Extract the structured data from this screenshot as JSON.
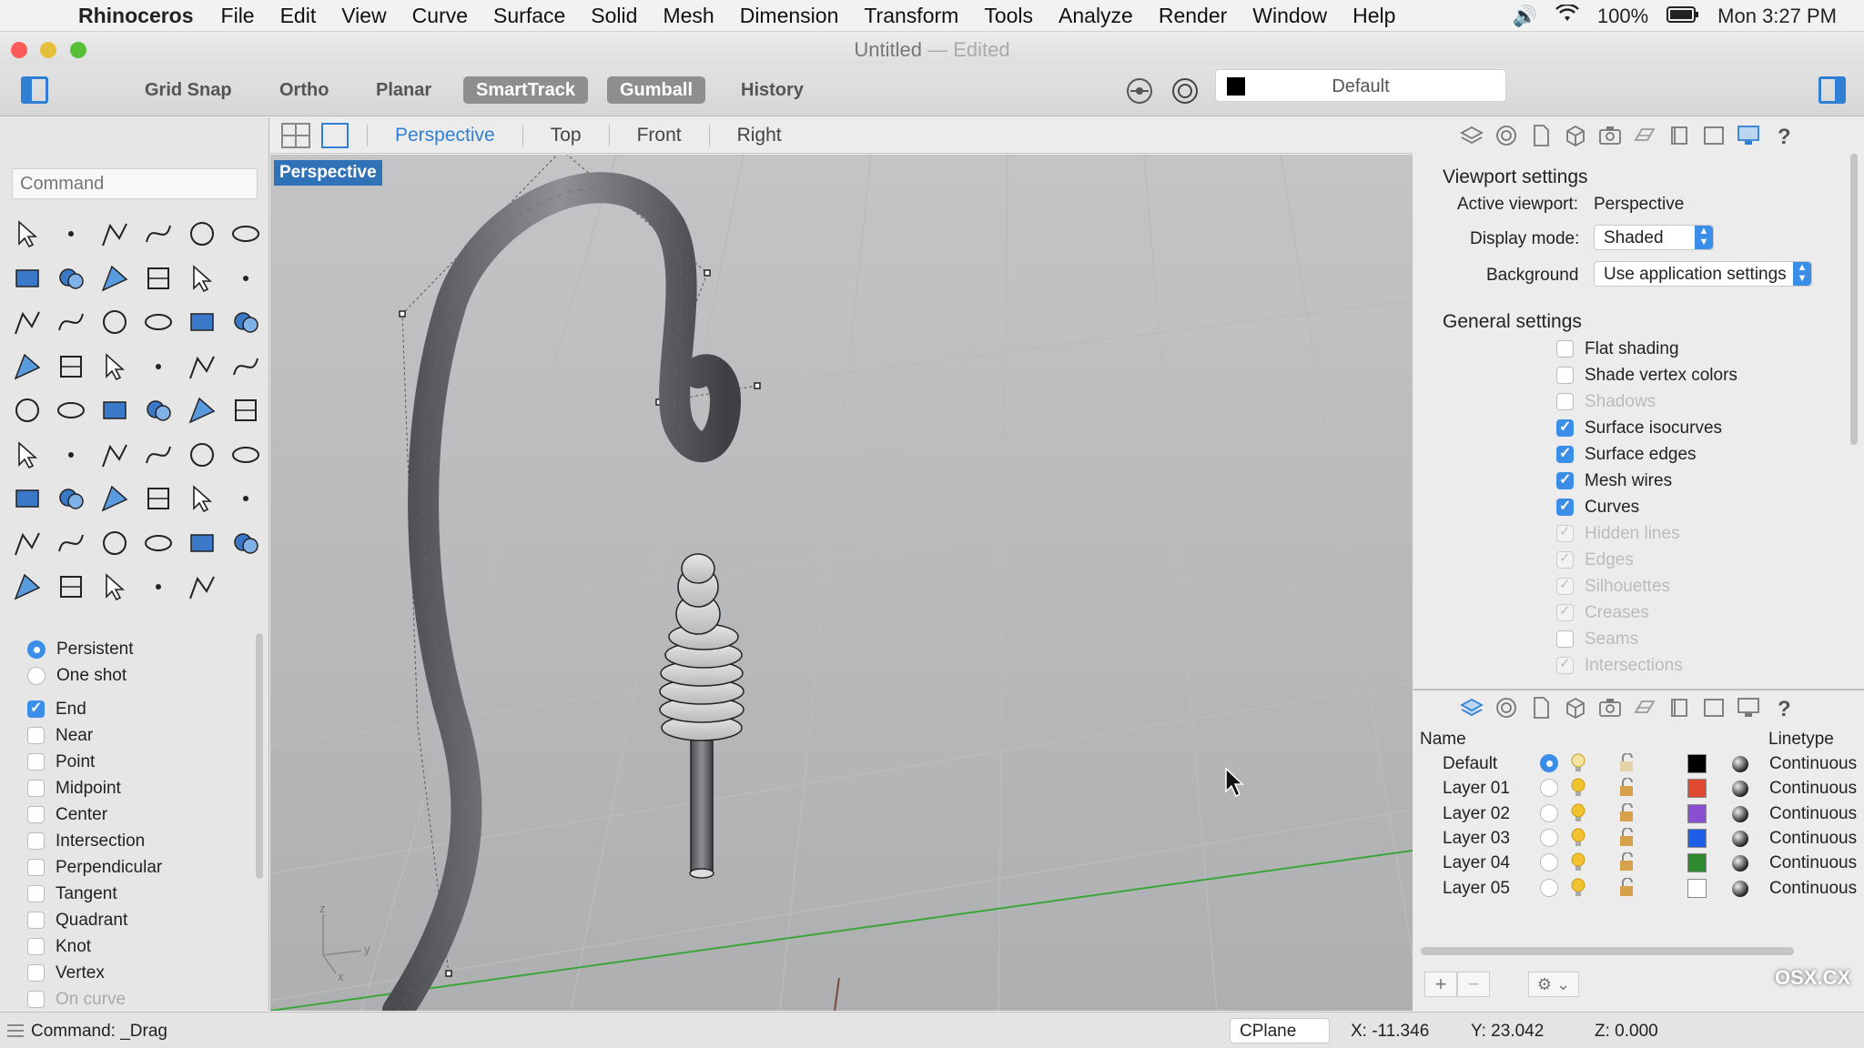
{
  "menubar": {
    "app_name": "Rhinoceros",
    "items": [
      "File",
      "Edit",
      "View",
      "Curve",
      "Surface",
      "Solid",
      "Mesh",
      "Dimension",
      "Transform",
      "Tools",
      "Analyze",
      "Render",
      "Window",
      "Help"
    ],
    "battery": "100%",
    "clock": "Mon 3:27 PM"
  },
  "window": {
    "title": "Untitled",
    "edited": "— Edited"
  },
  "toolbar": {
    "buttons": [
      "Grid Snap",
      "Ortho",
      "Planar",
      "SmartTrack",
      "Gumball",
      "History"
    ],
    "active_buttons": [
      "SmartTrack",
      "Gumball"
    ],
    "current_layer": "Default"
  },
  "command": {
    "placeholder": "Command"
  },
  "tool_icons": [
    "select-arrow-icon",
    "point-icon",
    "polyline-icon",
    "curve-icon",
    "circle-icon",
    "ellipse-icon",
    "polygon-icon",
    "rectangle-icon",
    "hexagon-icon",
    "fillet-curve-icon",
    "surface-edge-icon",
    "sweep-icon",
    "box-icon",
    "sphere-cylinder-icon",
    "cylinder-icon",
    "plane-surface-icon",
    "gear-icon",
    "extrude-icon",
    "boolean-icon",
    "split-icon",
    "fillet-icon",
    "join-icon",
    "offset-icon",
    "blend-icon",
    "text-icon",
    "scale-icon",
    "array-icon",
    "dimension-icon",
    "solid-box-icon",
    "ruler-icon",
    "grid-array-icon",
    "align-icon",
    "pipe-icon",
    "check-icon",
    "analyze-icon",
    "curvature-icon",
    "zoom-icon",
    "zoom-window-icon",
    "zoom-extents-icon",
    "zoom-selected-icon",
    "rotate-view-icon",
    "car-icon",
    "grid-icon",
    "snap-icon",
    "light-icon",
    "lock-icon",
    "material-icon",
    "color-wheel-icon",
    "sphere-wire-icon",
    "globe-icon",
    "render-sphere-icon",
    "mirror-icon",
    "gumball-axes-icon"
  ],
  "osnap": {
    "mode": [
      {
        "label": "Persistent",
        "checked": true
      },
      {
        "label": "One shot",
        "checked": false
      }
    ],
    "snaps": [
      {
        "label": "End",
        "checked": true,
        "dim": false
      },
      {
        "label": "Near",
        "checked": false,
        "dim": false
      },
      {
        "label": "Point",
        "checked": false,
        "dim": false
      },
      {
        "label": "Midpoint",
        "checked": false,
        "dim": false
      },
      {
        "label": "Center",
        "checked": false,
        "dim": false
      },
      {
        "label": "Intersection",
        "checked": false,
        "dim": false
      },
      {
        "label": "Perpendicular",
        "checked": false,
        "dim": false
      },
      {
        "label": "Tangent",
        "checked": false,
        "dim": false
      },
      {
        "label": "Quadrant",
        "checked": false,
        "dim": false
      },
      {
        "label": "Knot",
        "checked": false,
        "dim": false
      },
      {
        "label": "Vertex",
        "checked": false,
        "dim": false
      },
      {
        "label": "On curve",
        "checked": false,
        "dim": true
      }
    ]
  },
  "viewport": {
    "tabs": [
      "Perspective",
      "Top",
      "Front",
      "Right"
    ],
    "active_tab": "Perspective",
    "label": "Perspective",
    "axis_labels": {
      "z": "z",
      "y": "y",
      "x": "x"
    }
  },
  "viewport_settings": {
    "heading": "Viewport settings",
    "active_viewport_label": "Active viewport:",
    "active_viewport_value": "Perspective",
    "display_mode_label": "Display mode:",
    "display_mode_value": "Shaded",
    "background_label": "Background",
    "background_value": "Use application settings"
  },
  "general_settings": {
    "heading": "General settings",
    "items": [
      {
        "label": "Flat shading",
        "checked": false,
        "dim": false
      },
      {
        "label": "Shade vertex colors",
        "checked": false,
        "dim": false
      },
      {
        "label": "Shadows",
        "checked": false,
        "dim": true
      },
      {
        "label": "Surface isocurves",
        "checked": true,
        "dim": false
      },
      {
        "label": "Surface edges",
        "checked": true,
        "dim": false
      },
      {
        "label": "Mesh wires",
        "checked": true,
        "dim": false
      },
      {
        "label": "Curves",
        "checked": true,
        "dim": false
      },
      {
        "label": "Hidden lines",
        "checked": true,
        "dim": true
      },
      {
        "label": "Edges",
        "checked": true,
        "dim": true
      },
      {
        "label": "Silhouettes",
        "checked": true,
        "dim": true
      },
      {
        "label": "Creases",
        "checked": true,
        "dim": true
      },
      {
        "label": "Seams",
        "checked": false,
        "dim": true
      },
      {
        "label": "Intersections",
        "checked": true,
        "dim": true
      }
    ]
  },
  "layers": {
    "col_name": "Name",
    "col_linetype": "Linetype",
    "rows": [
      {
        "name": "Default",
        "current": true,
        "color": "#000000",
        "linetype": "Continuous"
      },
      {
        "name": "Layer 01",
        "current": false,
        "color": "#e0482f",
        "linetype": "Continuous"
      },
      {
        "name": "Layer 02",
        "current": false,
        "color": "#8a4fd0",
        "linetype": "Continuous"
      },
      {
        "name": "Layer 03",
        "current": false,
        "color": "#1f5ee8",
        "linetype": "Continuous"
      },
      {
        "name": "Layer 04",
        "current": false,
        "color": "#2f8a2f",
        "linetype": "Continuous"
      },
      {
        "name": "Layer 05",
        "current": false,
        "color": "#ffffff",
        "linetype": "Continuous"
      }
    ],
    "add_label": "+",
    "remove_label": "−",
    "gear_label": "⚙ ⌄"
  },
  "statusbar": {
    "command": "Command: _Drag",
    "cplane": "CPlane",
    "x": "X: -11.346",
    "y": "Y: 23.042",
    "z": "Z: 0.000"
  },
  "watermark": "OSX.CX",
  "colors": {
    "accent": "#2f7fd4",
    "checkbox": "#3b8ee8",
    "axis_green": "#3aa63a"
  }
}
